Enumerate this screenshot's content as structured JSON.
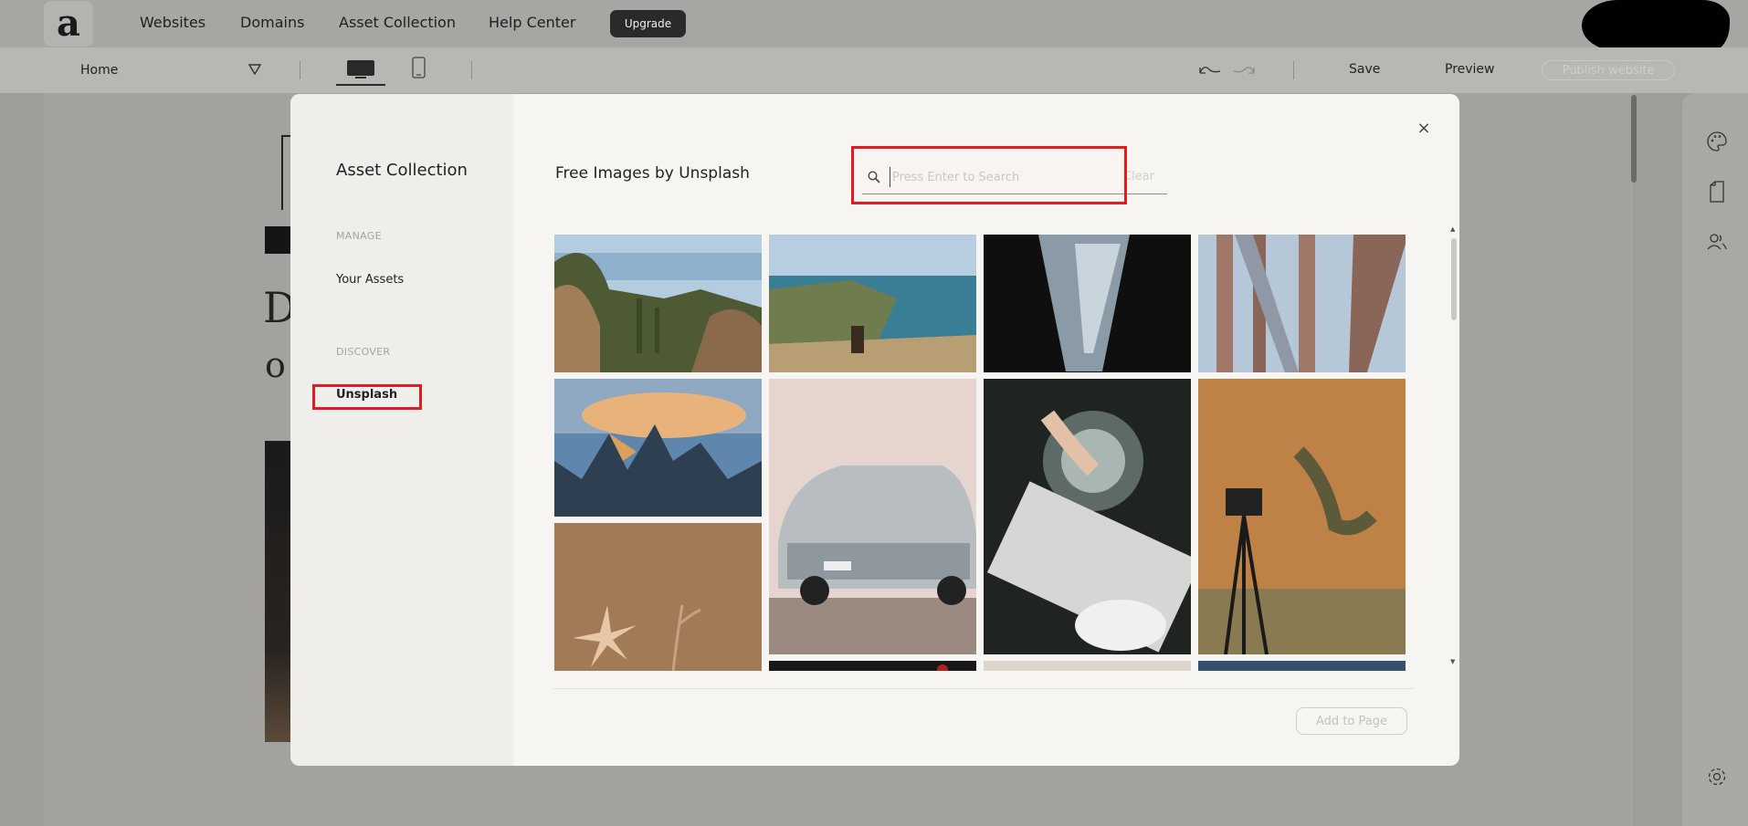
{
  "nav": {
    "logo_letter": "a",
    "links": [
      "Websites",
      "Domains",
      "Asset Collection",
      "Help Center"
    ],
    "upgrade_label": "Upgrade"
  },
  "toolbar": {
    "page_name": "Home",
    "save_label": "Save",
    "preview_label": "Preview",
    "publish_label": "Publish website"
  },
  "canvas": {
    "heading_fragment_1": "D",
    "heading_fragment_2": "o"
  },
  "modal": {
    "title": "Asset Collection",
    "sections": [
      {
        "label": "MANAGE",
        "items": [
          "Your Assets"
        ]
      },
      {
        "label": "DISCOVER",
        "items": [
          "Unsplash"
        ]
      }
    ],
    "active_item": "Unsplash",
    "gallery_title": "Free Images by Unsplash",
    "search": {
      "placeholder": "Press Enter to Search",
      "value": "",
      "clear_label": "Clear"
    },
    "close_icon": "close-icon",
    "add_button_label": "Add to Page",
    "images": [
      "desert-cactus-salt-flat",
      "coastal-cliffs-woman",
      "building-looking-up",
      "bridge-structure-beams",
      "mountain-peaks-sunrise",
      "vintage-silver-bmw",
      "console-hand-disassembly",
      "camera-tripod-rock-climber",
      "paper-star-ornament",
      "dark-bottom-partial",
      "light-bottom-partial",
      "blue-bottom-partial"
    ]
  },
  "colors": {
    "highlight": "#e11b22",
    "dark_button": "#2a2a2a"
  }
}
